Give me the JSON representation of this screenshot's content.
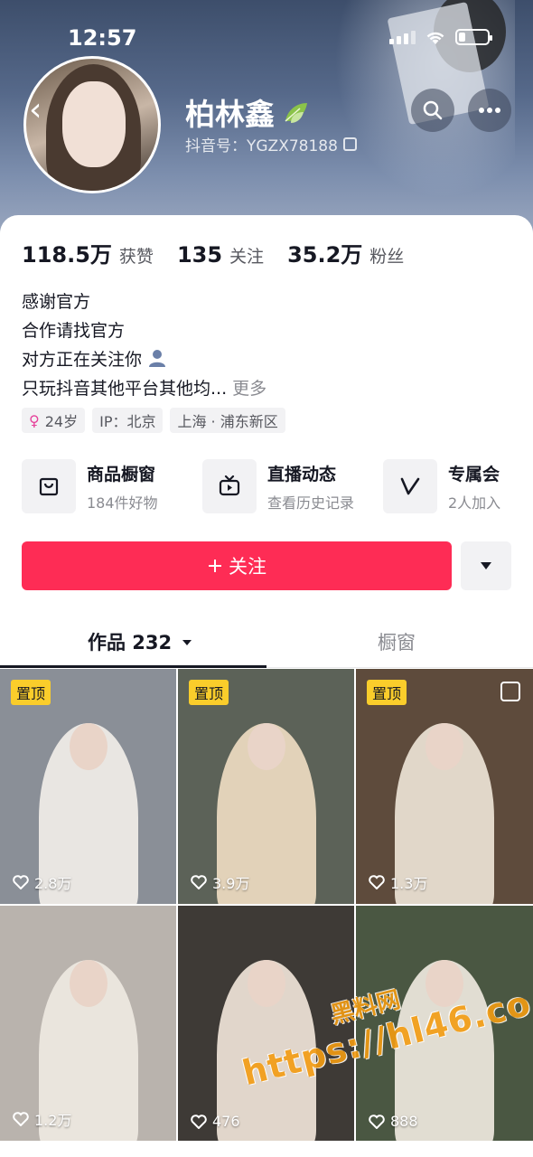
{
  "status_bar": {
    "time": "12:57"
  },
  "profile": {
    "name": "柏林鑫",
    "douyin_id": "抖音号：YGZX78188"
  },
  "stats": [
    {
      "value": "118.5万",
      "label": "获赞"
    },
    {
      "value": "135",
      "label": "关注"
    },
    {
      "value": "35.2万",
      "label": "粉丝"
    }
  ],
  "bio": {
    "lines": [
      "感谢官方",
      "合作请找官方",
      "对方正在关注你",
      "只玩抖音其他平台其他均..."
    ],
    "more": "更多"
  },
  "tags": {
    "age": "24岁",
    "ip": "IP：北京",
    "location": "上海 · 浦东新区"
  },
  "features": [
    {
      "title": "商品橱窗",
      "subtitle": "184件好物",
      "icon": "shopping-bag-icon"
    },
    {
      "title": "直播动态",
      "subtitle": "查看历史记录",
      "icon": "tv-icon"
    },
    {
      "title": "专属会",
      "subtitle": "2人加入",
      "icon": "v-icon"
    }
  ],
  "follow_button": {
    "label": "关注"
  },
  "tabs": {
    "works": "作品 232",
    "shop": "橱窗"
  },
  "videos": [
    {
      "pinned": "置顶",
      "likes": "2.8万",
      "bg": "#8a8f97",
      "fig": "#f3f0ea"
    },
    {
      "pinned": "置顶",
      "likes": "3.9万",
      "bg": "#5c6258",
      "fig": "#f1dfc4"
    },
    {
      "pinned": "置顶",
      "likes": "1.3万",
      "bg": "#5e4b3c",
      "fig": "#f0e7d8"
    },
    {
      "pinned": "",
      "likes": "1.2万",
      "bg": "#b9b3ad",
      "fig": "#efeae2"
    },
    {
      "pinned": "",
      "likes": "476",
      "bg": "#3e3a36",
      "fig": "#f3e8dc"
    },
    {
      "pinned": "",
      "likes": "888",
      "bg": "#4a5742",
      "fig": "#f2ece2"
    }
  ],
  "watermark": {
    "line1": "黑料网",
    "line2": "https://hl46.co"
  }
}
